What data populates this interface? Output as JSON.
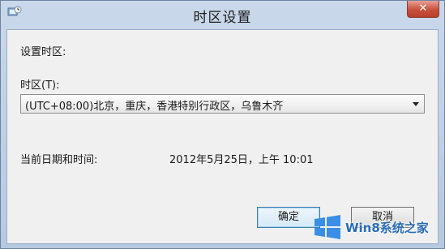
{
  "window": {
    "title": "时区设置",
    "close_label": "✕"
  },
  "dialog": {
    "heading": "设置时区:",
    "timezone_label": "时区(T):",
    "timezone_selected": "(UTC+08:00)北京，重庆，香港特别行政区，乌鲁木齐",
    "current_datetime_label": "当前日期和时间:",
    "current_datetime_value": "2012年5月25日，上午 10:01"
  },
  "buttons": {
    "ok_label": "确定",
    "cancel_label": "取消"
  },
  "watermark": {
    "text": "Win8系统之家"
  },
  "colors": {
    "titlebar": "#c9d8ea",
    "client_bg": "#f0f0f0",
    "close_red": "#c7503c",
    "default_button_border": "#3c7fb1",
    "watermark_blue": "#2a6bb6"
  }
}
